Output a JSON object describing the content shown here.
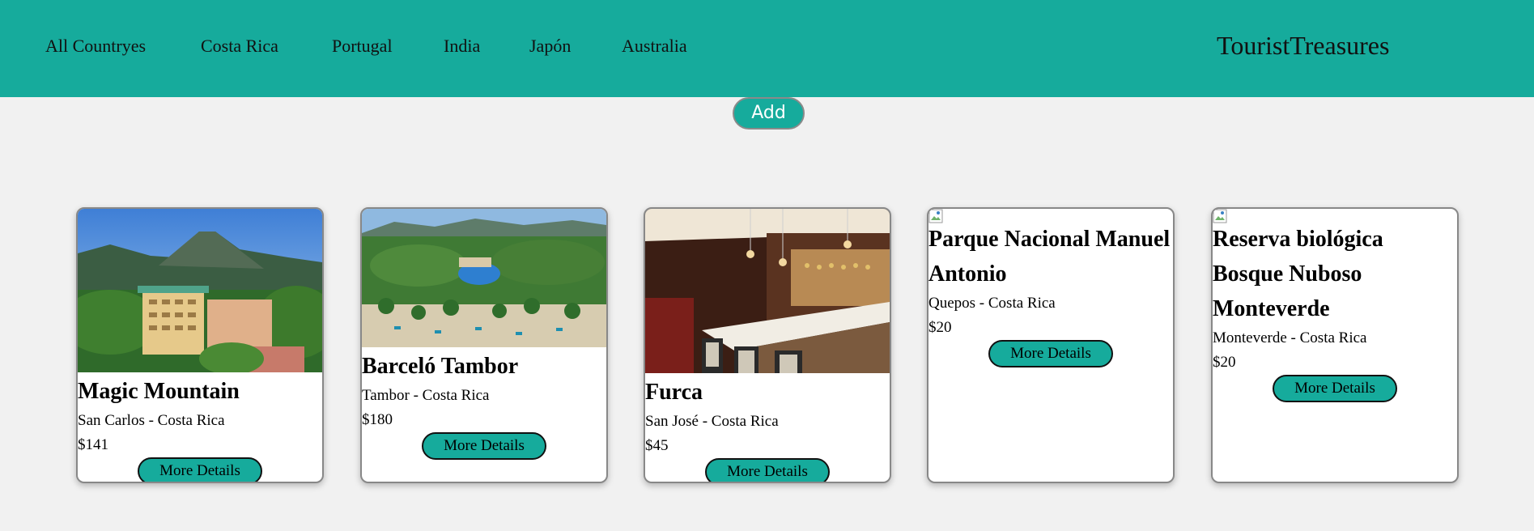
{
  "nav": {
    "links": [
      "All Countryes",
      "Costa Rica",
      "Portugal",
      "India",
      "Japón",
      "Australia"
    ],
    "brand": "TouristTreasures"
  },
  "actions": {
    "add_label": "Add"
  },
  "cards": [
    {
      "title": "Magic Mountain",
      "location": "San Carlos - Costa Rica",
      "price": "$141",
      "button": "More Details"
    },
    {
      "title": "Barceló Tambor",
      "location": "Tambor - Costa Rica",
      "price": "$180",
      "button": "More Details"
    },
    {
      "title": "Furca",
      "location": "San José - Costa Rica",
      "price": "$45",
      "button": "More Details"
    },
    {
      "title": "Parque Nacional Manuel Antonio",
      "location": "Quepos - Costa Rica",
      "price": "$20",
      "button": "More Details"
    },
    {
      "title": "Reserva biológica Bosque Nuboso Monteverde",
      "location": "Monteverde - Costa Rica",
      "price": "$20",
      "button": "More Details"
    }
  ],
  "colors": {
    "accent": "#16ab9c",
    "background": "#f1f1f1"
  }
}
